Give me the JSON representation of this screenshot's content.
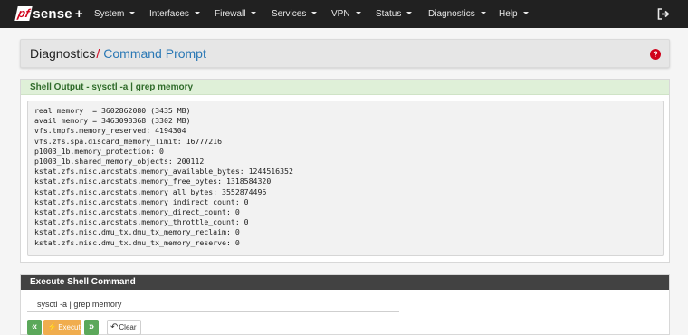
{
  "brand": {
    "pf": "pf",
    "sense": "sense",
    "plus": "+"
  },
  "nav": {
    "system": "System",
    "interfaces": "Interfaces",
    "firewall": "Firewall",
    "services": "Services",
    "vpn": "VPN",
    "status": "Status",
    "diagnostics": "Diagnostics",
    "help": "Help",
    "logout_icon": "logout-icon"
  },
  "breadcrumb": {
    "parent": "Diagnostics",
    "separator": "/",
    "current": "Command Prompt",
    "help_glyph": "?"
  },
  "output": {
    "title": "Shell Output - sysctl -a | grep memory",
    "lines": [
      "real memory  = 3602862080 (3435 MB)",
      "avail memory = 3463098368 (3302 MB)",
      "vfs.tmpfs.memory_reserved: 4194304",
      "vfs.zfs.spa.discard_memory_limit: 16777216",
      "p1003_1b.memory_protection: 0",
      "p1003_1b.shared_memory_objects: 200112",
      "kstat.zfs.misc.arcstats.memory_available_bytes: 1244516352",
      "kstat.zfs.misc.arcstats.memory_free_bytes: 1318584320",
      "kstat.zfs.misc.arcstats.memory_all_bytes: 3552874496",
      "kstat.zfs.misc.arcstats.memory_indirect_count: 0",
      "kstat.zfs.misc.arcstats.memory_direct_count: 0",
      "kstat.zfs.misc.arcstats.memory_throttle_count: 0",
      "kstat.zfs.misc.dmu_tx.dmu_tx_memory_reclaim: 0",
      "kstat.zfs.misc.dmu_tx.dmu_tx_memory_reserve: 0"
    ]
  },
  "execute": {
    "title": "Execute Shell Command",
    "command_value": "sysctl -a | grep memory",
    "prev_glyph": "«",
    "next_glyph": "»",
    "execute_label": "Execute",
    "clear_label": "Clear"
  },
  "colors": {
    "navbar": "#212121",
    "brand_red": "#d0021b",
    "link_blue": "#2a78b5",
    "success_bg": "#dff0d8",
    "success_text": "#2f6b2a",
    "panel_dark": "#424242",
    "btn_green": "#5ba85a",
    "btn_orange": "#f0ad4e"
  }
}
